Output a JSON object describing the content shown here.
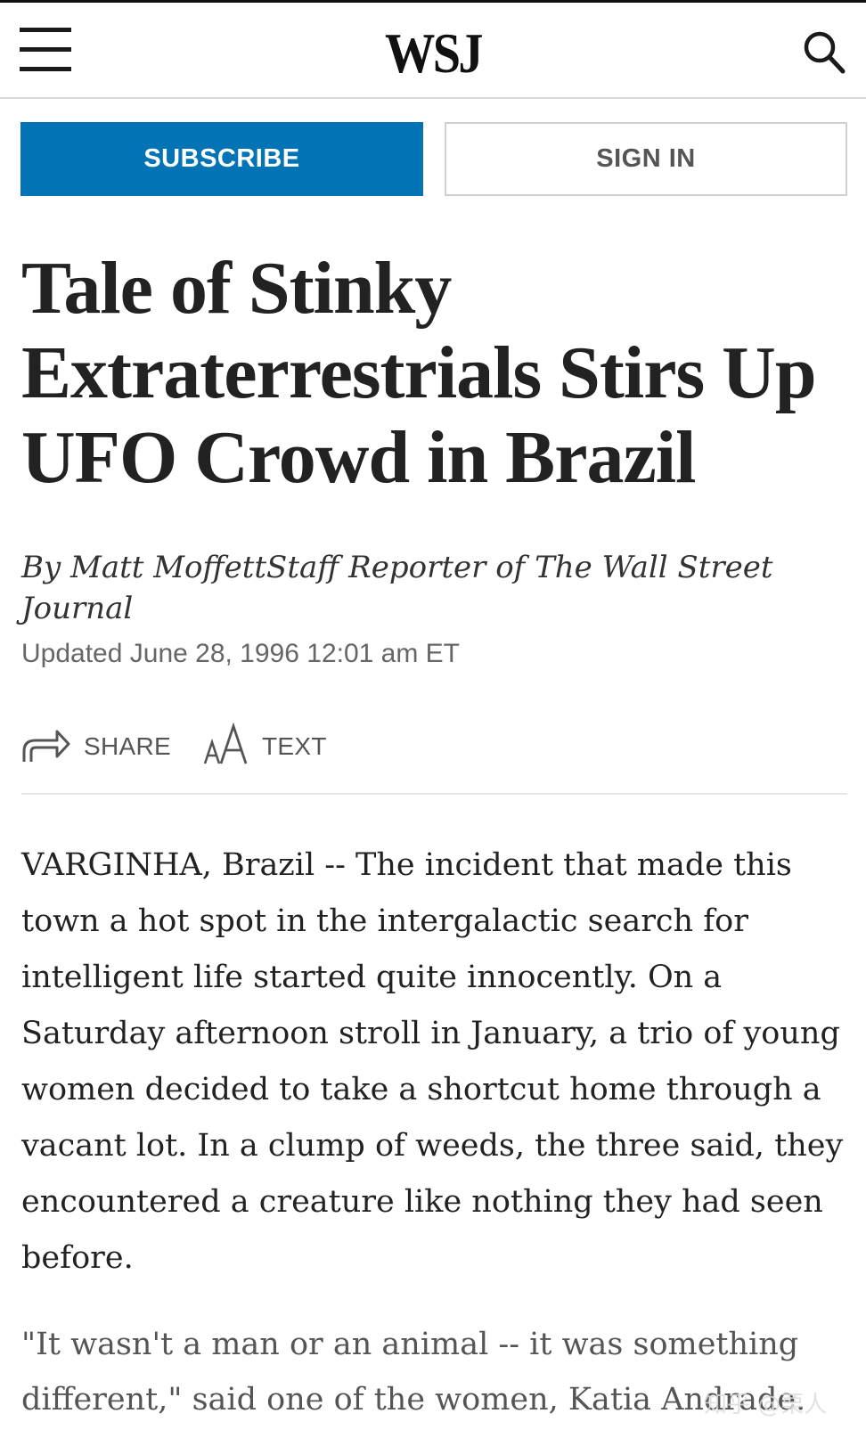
{
  "header": {
    "logo": "WSJ",
    "menu_icon": "hamburger-menu-icon",
    "search_icon": "search-icon"
  },
  "actions": {
    "subscribe_label": "SUBSCRIBE",
    "sign_in_label": "SIGN IN",
    "subscribe_color": "#0274b6"
  },
  "article": {
    "headline": "Tale of Stinky Extraterrestrials Stirs Up UFO Crowd in Brazil",
    "byline": "By Matt MoffettStaff Reporter of The Wall Street Journal",
    "updated": "Updated June 28, 1996 12:01 am ET",
    "tools": {
      "share_label": "SHARE",
      "share_icon": "share-arrow-icon",
      "text_label": "TEXT",
      "text_icon": "text-size-icon"
    },
    "paragraphs": [
      "VARGINHA, Brazil -- The incident that made this town a hot spot in the intergalactic search for intelligent life started quite innocently. On a Saturday afternoon stroll in January, a trio of young women decided to take a shortcut home through a vacant lot. In a clump of weeds, the three said, they encountered a creature like nothing they had seen before.",
      "\"It wasn't a man or an animal -- it was something different,\" said one of the women, Katia Andrade."
    ]
  },
  "watermark": "知乎 @栗人"
}
